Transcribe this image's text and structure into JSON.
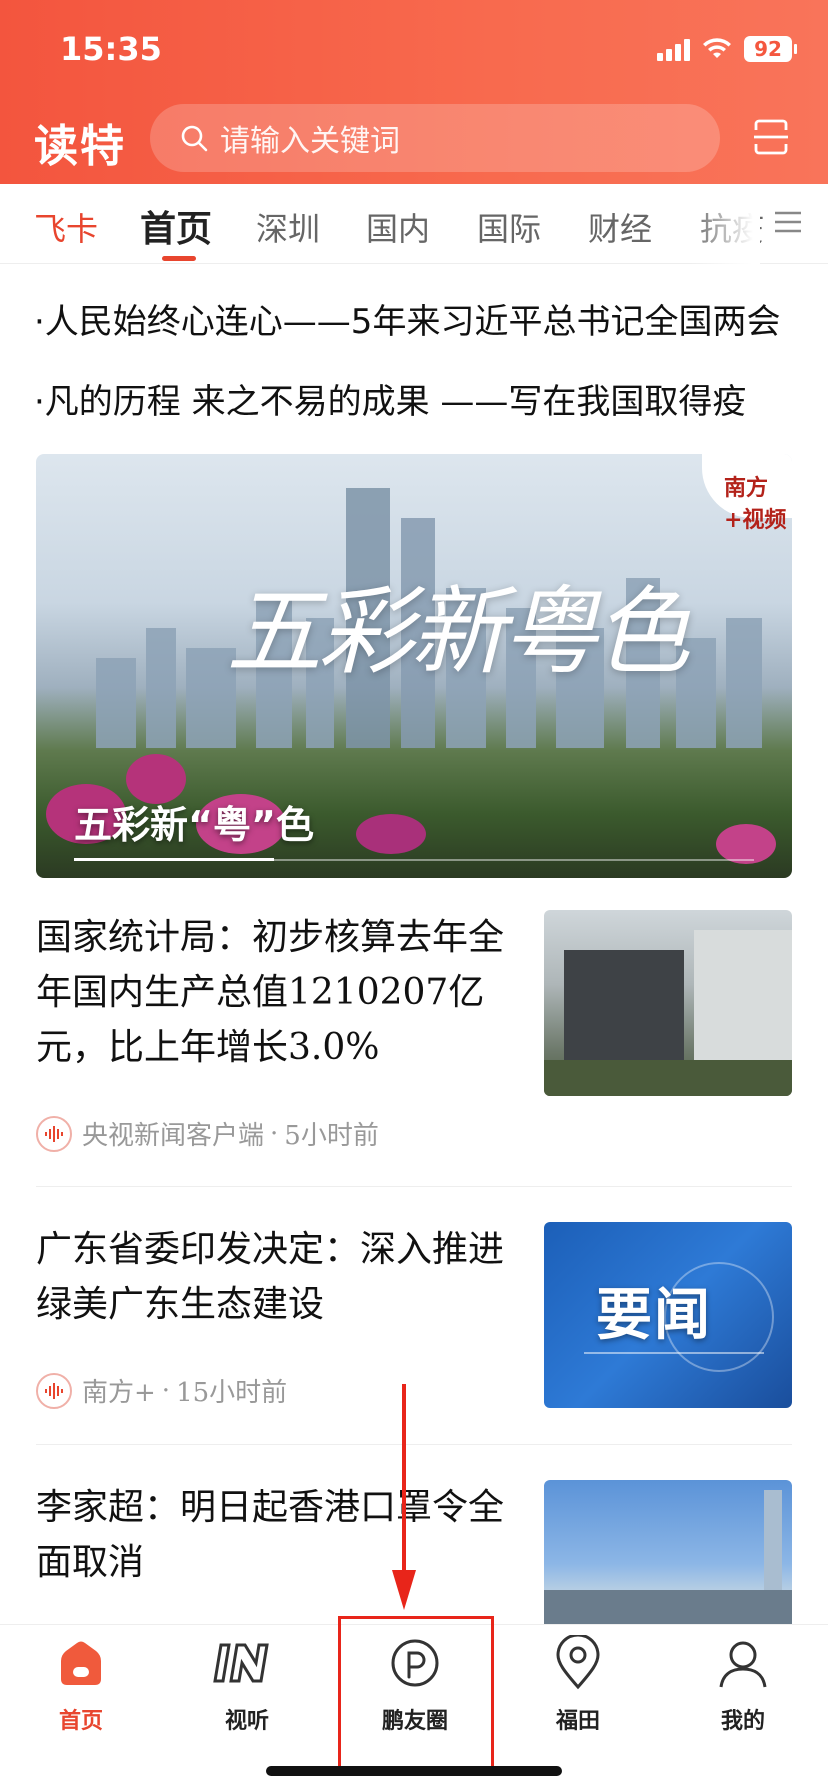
{
  "status_bar": {
    "time": "15:35",
    "battery": "92"
  },
  "header": {
    "logo": "读特",
    "search_placeholder": "请输入关键词"
  },
  "tabs": [
    "飞卡",
    "首页",
    "深圳",
    "国内",
    "国际",
    "财经",
    "抗疫"
  ],
  "active_tab": "首页",
  "ticker": [
    "·人民始终心连心——5年来习近平总书记全国两会",
    "·凡的历程 来之不易的成果 ——写在我国取得疫"
  ],
  "hero": {
    "big_text": "五彩新粤色",
    "caption": "五彩新“粤”色",
    "badge": "南方+视频"
  },
  "news": [
    {
      "title": "国家统计局：初步核算去年全年国内生产总值1210207亿元，比上年增长3.0%",
      "source": "央视新闻客户端",
      "time": "5小时前"
    },
    {
      "title": "广东省委印发决定：深入推进绿美广东生态建设",
      "source": "南方+",
      "time": "15小时前",
      "thumb_text": "要闻"
    },
    {
      "title": "李家超：明日起香港口罩令全面取消"
    }
  ],
  "meta_sep": "·",
  "bottom_nav": [
    "首页",
    "视听",
    "鹏友圈",
    "福田",
    "我的"
  ],
  "colors": {
    "brand": "#f3553e",
    "accent": "#e8452e",
    "highlight": "#e8251a"
  }
}
